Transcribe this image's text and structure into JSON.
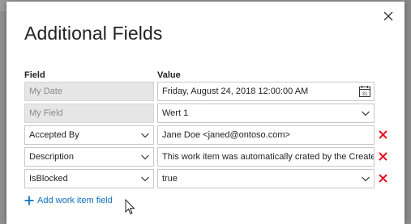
{
  "dialog": {
    "title": "Additional Fields",
    "close_label": "×"
  },
  "columns": {
    "field": "Field",
    "value": "Value"
  },
  "rows": [
    {
      "field": "My Date",
      "value": "Friday, August 24, 2018 12:00:00 AM",
      "disabled": true,
      "control": "date",
      "removable": false
    },
    {
      "field": "My Field",
      "value": "Wert 1",
      "disabled": true,
      "control": "dropdown",
      "removable": false
    },
    {
      "field": "Accepted By",
      "value": "Jane Doe <janed@ontoso.com>",
      "disabled": false,
      "control": "text",
      "removable": true
    },
    {
      "field": "Description",
      "value": "This work item was automatically crated by the Create W",
      "disabled": false,
      "control": "text",
      "removable": true
    },
    {
      "field": "IsBlocked",
      "value": "true",
      "disabled": false,
      "control": "dropdown",
      "removable": true
    }
  ],
  "add_field_label": "Add work item field",
  "icons": {
    "close": "close-icon",
    "chevron": "chevron-down-icon",
    "calendar": "calendar-icon",
    "delete": "delete-icon",
    "add": "plus-icon",
    "calendar_day": "31"
  },
  "colors": {
    "accent": "#106ebe",
    "delete": "#e81123"
  }
}
